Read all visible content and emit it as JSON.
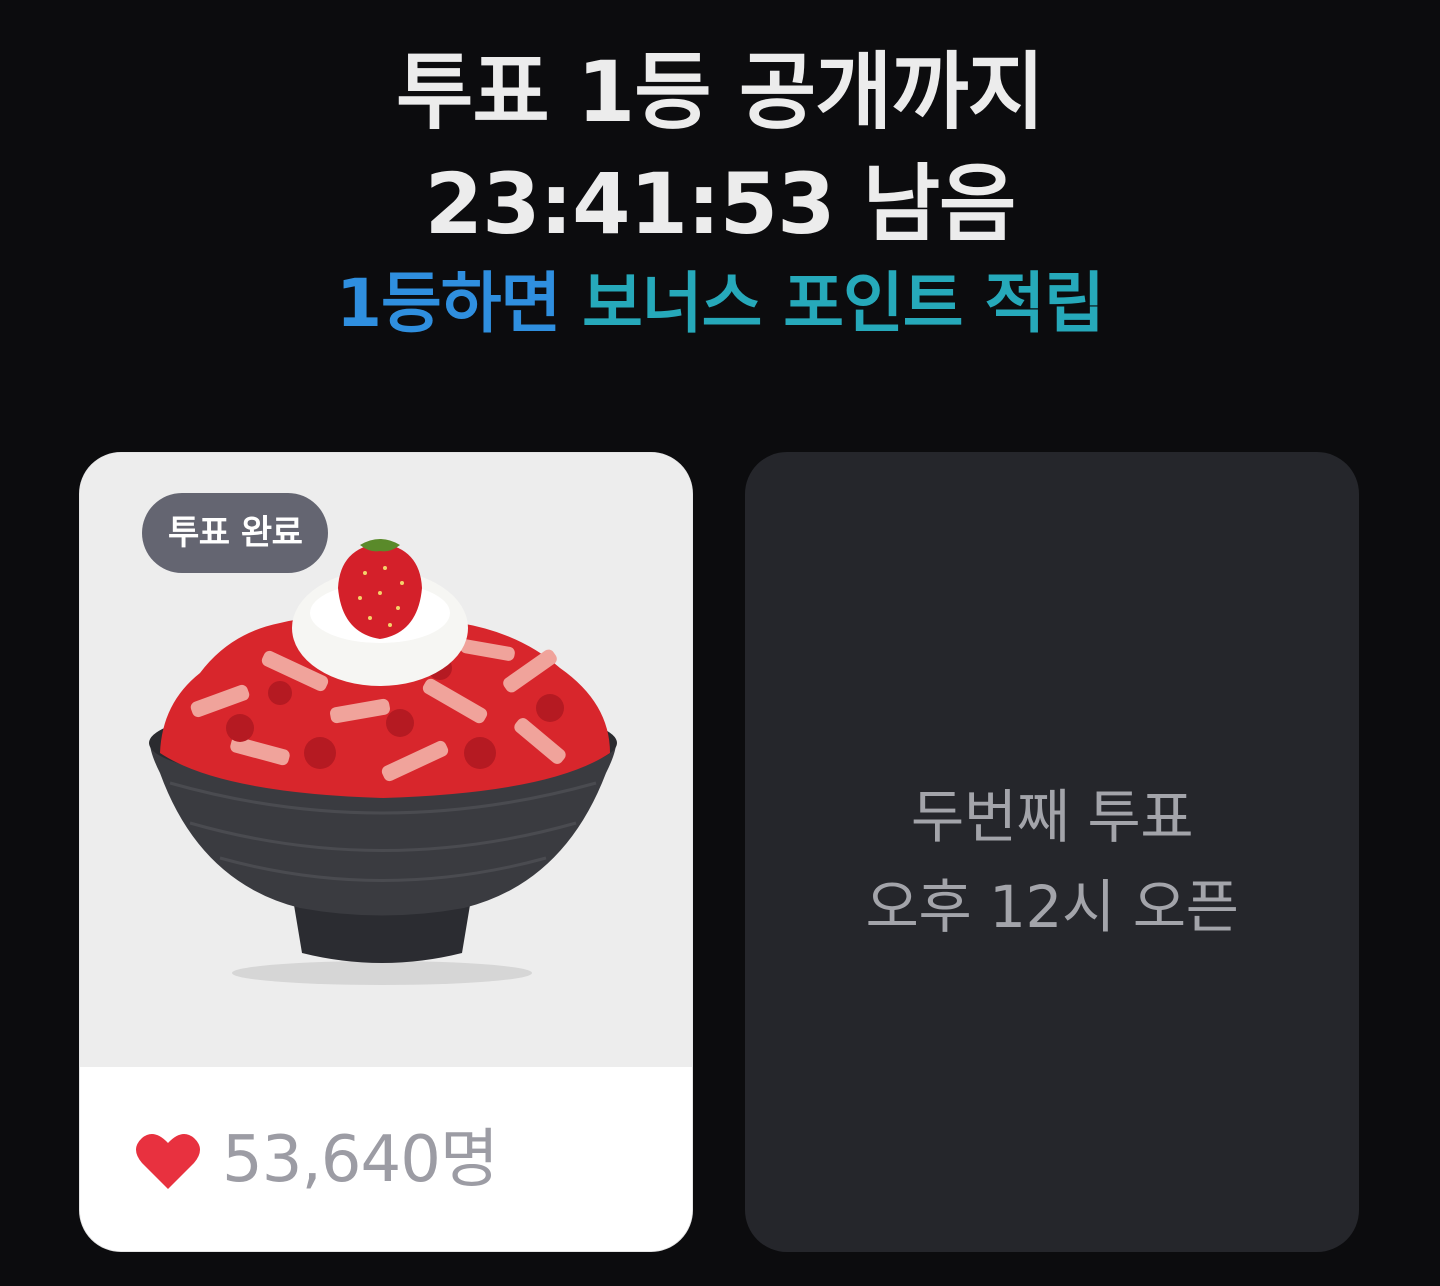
{
  "header": {
    "title_line1": "투표 1등 공개까지",
    "title_line2": "23:41:53 남음",
    "bonus_part1": "1등하면",
    "bonus_part2": "보너스 포인트 적립",
    "bonus_color1": "#2f8fdf",
    "bonus_color2": "#26a9ba"
  },
  "vote_card": {
    "badge": "투표 완료",
    "image_icon": "strawberry-bingsu-image",
    "heart_icon": "heart-icon",
    "heart_color": "#e8313f",
    "vote_count": "53,640명"
  },
  "next_card": {
    "line1": "두번째 투표",
    "line2": "오후 12시 오픈"
  }
}
